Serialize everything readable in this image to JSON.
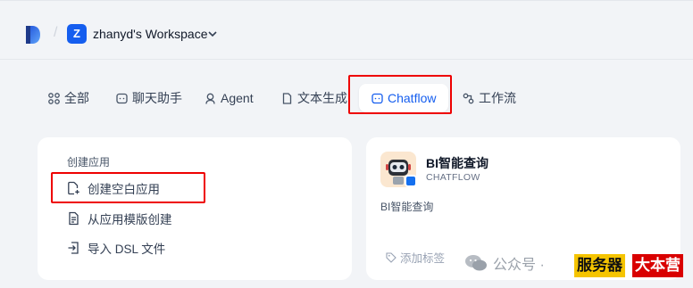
{
  "header": {
    "workspace_initial": "Z",
    "workspace_name": "zhanyd's Workspace"
  },
  "tabs": [
    {
      "label": "全部",
      "icon": "grid-icon"
    },
    {
      "label": "聊天助手",
      "icon": "chat-icon"
    },
    {
      "label": "Agent",
      "icon": "agent-icon"
    },
    {
      "label": "文本生成",
      "icon": "document-icon"
    },
    {
      "label": "Chatflow",
      "icon": "chatflow-icon",
      "active": true
    },
    {
      "label": "工作流",
      "icon": "workflow-icon"
    }
  ],
  "create_card": {
    "section_title": "创建应用",
    "actions": [
      {
        "label": "创建空白应用",
        "icon": "new-file-icon"
      },
      {
        "label": "从应用模版创建",
        "icon": "template-icon"
      },
      {
        "label": "导入 DSL 文件",
        "icon": "import-icon"
      }
    ]
  },
  "app_card": {
    "title": "BI智能查询",
    "type": "CHATFLOW",
    "description": "BI智能查询",
    "tag_label": "添加标签"
  },
  "watermark": {
    "text": "公众号 ·",
    "stamp_left": "服务器",
    "stamp_right": "大本营"
  },
  "colors": {
    "accent": "#155eef",
    "highlight_box": "#e00000",
    "background": "#f2f4f7"
  }
}
